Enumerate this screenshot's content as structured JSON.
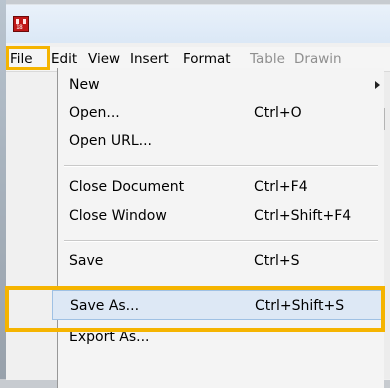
{
  "app": {
    "icon_name": "editor-app-icon",
    "icon_text": "18"
  },
  "menubar": {
    "items": [
      {
        "label": "File",
        "disabled": false
      },
      {
        "label": "Edit",
        "disabled": false
      },
      {
        "label": "View",
        "disabled": false
      },
      {
        "label": "Insert",
        "disabled": false
      },
      {
        "label": "Format",
        "disabled": false
      },
      {
        "label": "Table",
        "disabled": true
      },
      {
        "label": "Drawin",
        "disabled": true
      }
    ]
  },
  "file_menu": {
    "items": [
      {
        "label": "New",
        "shortcut": "",
        "has_submenu": true
      },
      {
        "label": "Open...",
        "shortcut": "Ctrl+O"
      },
      {
        "label": "Open URL...",
        "shortcut": ""
      },
      {
        "label": "Close Document",
        "shortcut": "Ctrl+F4"
      },
      {
        "label": "Close Window",
        "shortcut": "Ctrl+Shift+F4"
      },
      {
        "label": "Save",
        "shortcut": "Ctrl+S"
      },
      {
        "label": "Save As...",
        "shortcut": "Ctrl+Shift+S",
        "highlighted": true
      },
      {
        "label": "Export As...",
        "shortcut": ""
      }
    ]
  },
  "colors": {
    "annotation_highlight": "#f5b400",
    "hover_fill": "#dde8f5",
    "hover_border": "#9fc1e4"
  }
}
